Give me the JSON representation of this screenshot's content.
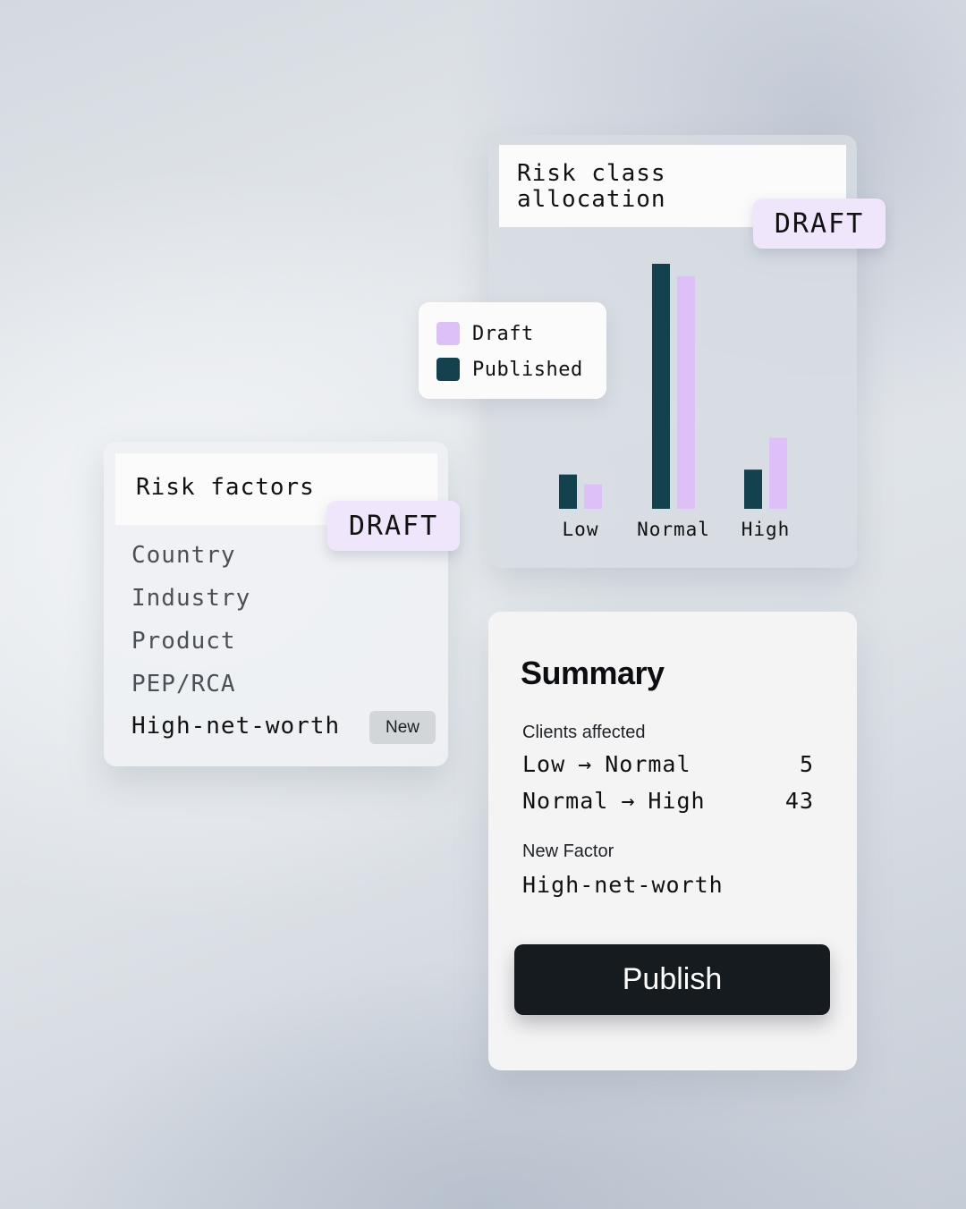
{
  "allocation_card": {
    "title_line1": "Risk class",
    "title_line2": "allocation",
    "badge": "DRAFT",
    "legend": {
      "draft_label": "Draft",
      "published_label": "Published"
    }
  },
  "chart_data": {
    "type": "bar",
    "categories": [
      "Low",
      "Normal",
      "High"
    ],
    "series": [
      {
        "name": "Published",
        "values": [
          14,
          100,
          16
        ],
        "color": "#13424e"
      },
      {
        "name": "Draft",
        "values": [
          10,
          95,
          29
        ],
        "color": "#dcc0f7"
      }
    ],
    "title": "Risk class allocation",
    "ylim": [
      0,
      100
    ],
    "grid": false,
    "legend_position": "left"
  },
  "factors_card": {
    "title": "Risk factors",
    "badge": "DRAFT",
    "items": [
      "Country",
      "Industry",
      "Product",
      "PEP/RCA",
      "High-net-worth"
    ],
    "new_badge": "New"
  },
  "summary_card": {
    "title": "Summary",
    "clients_label": "Clients affected",
    "rows": [
      {
        "from": "Low",
        "arrow": "→",
        "to": "Normal",
        "count": "5"
      },
      {
        "from": "Normal",
        "arrow": "→",
        "to": "High",
        "count": "43"
      }
    ],
    "new_factor_label": "New Factor",
    "new_factor_value": "High-net-worth",
    "publish_label": "Publish"
  },
  "colors": {
    "draft": "#dcc0f7",
    "published": "#13424e",
    "badge_bg": "#efe6fb",
    "button_bg": "#161b1f"
  }
}
